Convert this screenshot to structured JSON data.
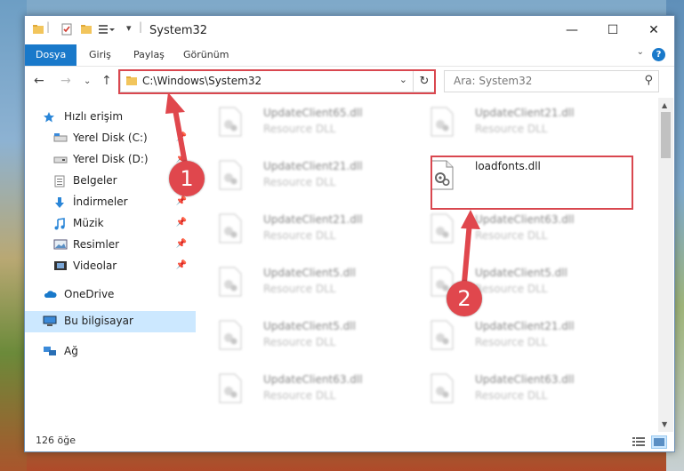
{
  "window": {
    "title": "System32"
  },
  "ribbon": {
    "tabs": [
      {
        "label": "Dosya",
        "active": true
      },
      {
        "label": "Giriş",
        "active": false
      },
      {
        "label": "Paylaş",
        "active": false
      },
      {
        "label": "Görünüm",
        "active": false
      }
    ],
    "help_label": "?"
  },
  "nav": {
    "address": "C:\\Windows\\System32",
    "search_placeholder": "Ara: System32"
  },
  "sidebar": {
    "items": [
      {
        "label": "Hızlı erişim",
        "icon": "star-icon"
      },
      {
        "label": "Yerel Disk (C:)",
        "icon": "drive-icon",
        "pinned": true
      },
      {
        "label": "Yerel Disk (D:)",
        "icon": "drive-icon",
        "pinned": true
      },
      {
        "label": "Belgeler",
        "icon": "document-icon",
        "pinned": true
      },
      {
        "label": "İndirmeler",
        "icon": "download-icon",
        "pinned": true
      },
      {
        "label": "Müzik",
        "icon": "music-icon",
        "pinned": true
      },
      {
        "label": "Resimler",
        "icon": "picture-icon",
        "pinned": true
      },
      {
        "label": "Videolar",
        "icon": "video-icon",
        "pinned": true
      },
      {
        "label": "OneDrive",
        "icon": "cloud-icon"
      },
      {
        "label": "Bu bilgisayar",
        "icon": "computer-icon",
        "selected": true
      },
      {
        "label": "Ağ",
        "icon": "network-icon"
      }
    ]
  },
  "files": {
    "left_column": [
      {
        "name": "UpdateClient65.dll",
        "type": "Resource DLL"
      },
      {
        "name": "UpdateClient21.dll",
        "type": "Resource DLL"
      },
      {
        "name": "UpdateClient21.dll",
        "type": "Resource DLL"
      },
      {
        "name": "UpdateClient5.dll",
        "type": "Resource DLL"
      },
      {
        "name": "UpdateClient5.dll",
        "type": "Resource DLL"
      },
      {
        "name": "UpdateClient63.dll",
        "type": "Resource DLL"
      }
    ],
    "right_column": [
      {
        "name": "UpdateClient21.dll",
        "type": "Resource DLL"
      },
      {
        "name": "loadfonts.dll",
        "type": "",
        "highlighted": true
      },
      {
        "name": "UpdateClient63.dll",
        "type": "Resource DLL"
      },
      {
        "name": "UpdateClient5.dll",
        "type": "Resource DLL"
      },
      {
        "name": "UpdateClient21.dll",
        "type": "Resource DLL"
      },
      {
        "name": "UpdateClient63.dll",
        "type": "Resource DLL"
      }
    ]
  },
  "status": {
    "count_text": "126 öğe"
  },
  "annotations": {
    "badge1": "1",
    "badge2": "2",
    "color": "#e0474d"
  },
  "colors": {
    "accent": "#1979ca",
    "selected": "#cce8ff"
  }
}
